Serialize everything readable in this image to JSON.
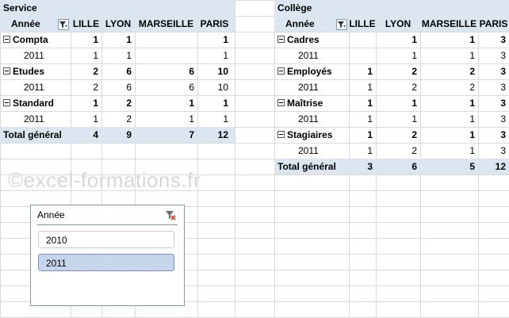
{
  "pivot1": {
    "field": "Service",
    "row_field": "Année",
    "columns": [
      "LILLE",
      "LYON",
      "MARSEILLE",
      "PARIS"
    ],
    "rows": [
      {
        "label": "Compta",
        "values": [
          "1",
          "1",
          "",
          "1"
        ],
        "group": true
      },
      {
        "label": "2011",
        "values": [
          "1",
          "1",
          "",
          "1"
        ],
        "group": false
      },
      {
        "label": "Etudes",
        "values": [
          "2",
          "6",
          "6",
          "10"
        ],
        "group": true
      },
      {
        "label": "2011",
        "values": [
          "2",
          "6",
          "6",
          "10"
        ],
        "group": false
      },
      {
        "label": "Standard",
        "values": [
          "1",
          "2",
          "1",
          "1"
        ],
        "group": true
      },
      {
        "label": "2011",
        "values": [
          "1",
          "2",
          "1",
          "1"
        ],
        "group": false
      }
    ],
    "total": {
      "label": "Total général",
      "values": [
        "4",
        "9",
        "7",
        "12"
      ]
    }
  },
  "pivot2": {
    "field": "Collège",
    "row_field": "Année",
    "columns": [
      "LILLE",
      "LYON",
      "MARSEILLE",
      "PARIS"
    ],
    "rows": [
      {
        "label": "Cadres",
        "values": [
          "",
          "1",
          "1",
          "3"
        ],
        "group": true
      },
      {
        "label": "2011",
        "values": [
          "",
          "1",
          "1",
          "3"
        ],
        "group": false
      },
      {
        "label": "Employés",
        "values": [
          "1",
          "2",
          "2",
          "3"
        ],
        "group": true
      },
      {
        "label": "2011",
        "values": [
          "1",
          "2",
          "2",
          "3"
        ],
        "group": false
      },
      {
        "label": "Maîtrise",
        "values": [
          "1",
          "1",
          "1",
          "3"
        ],
        "group": true
      },
      {
        "label": "2011",
        "values": [
          "1",
          "1",
          "1",
          "3"
        ],
        "group": false
      },
      {
        "label": "Stagiaires",
        "values": [
          "1",
          "2",
          "1",
          "3"
        ],
        "group": true
      },
      {
        "label": "2011",
        "values": [
          "1",
          "2",
          "1",
          "3"
        ],
        "group": false
      }
    ],
    "total": {
      "label": "Total général",
      "values": [
        "3",
        "6",
        "5",
        "12"
      ]
    }
  },
  "watermark": "©excel-formations.fr",
  "slicer": {
    "title": "Année",
    "items": [
      {
        "label": "2010",
        "selected": false
      },
      {
        "label": "2011",
        "selected": true
      }
    ],
    "icon": "clear-filter-icon"
  },
  "colors": {
    "header_bg": "#dce6f1",
    "grid": "#d9d9d9",
    "slicer_border": "#7a97c0"
  }
}
